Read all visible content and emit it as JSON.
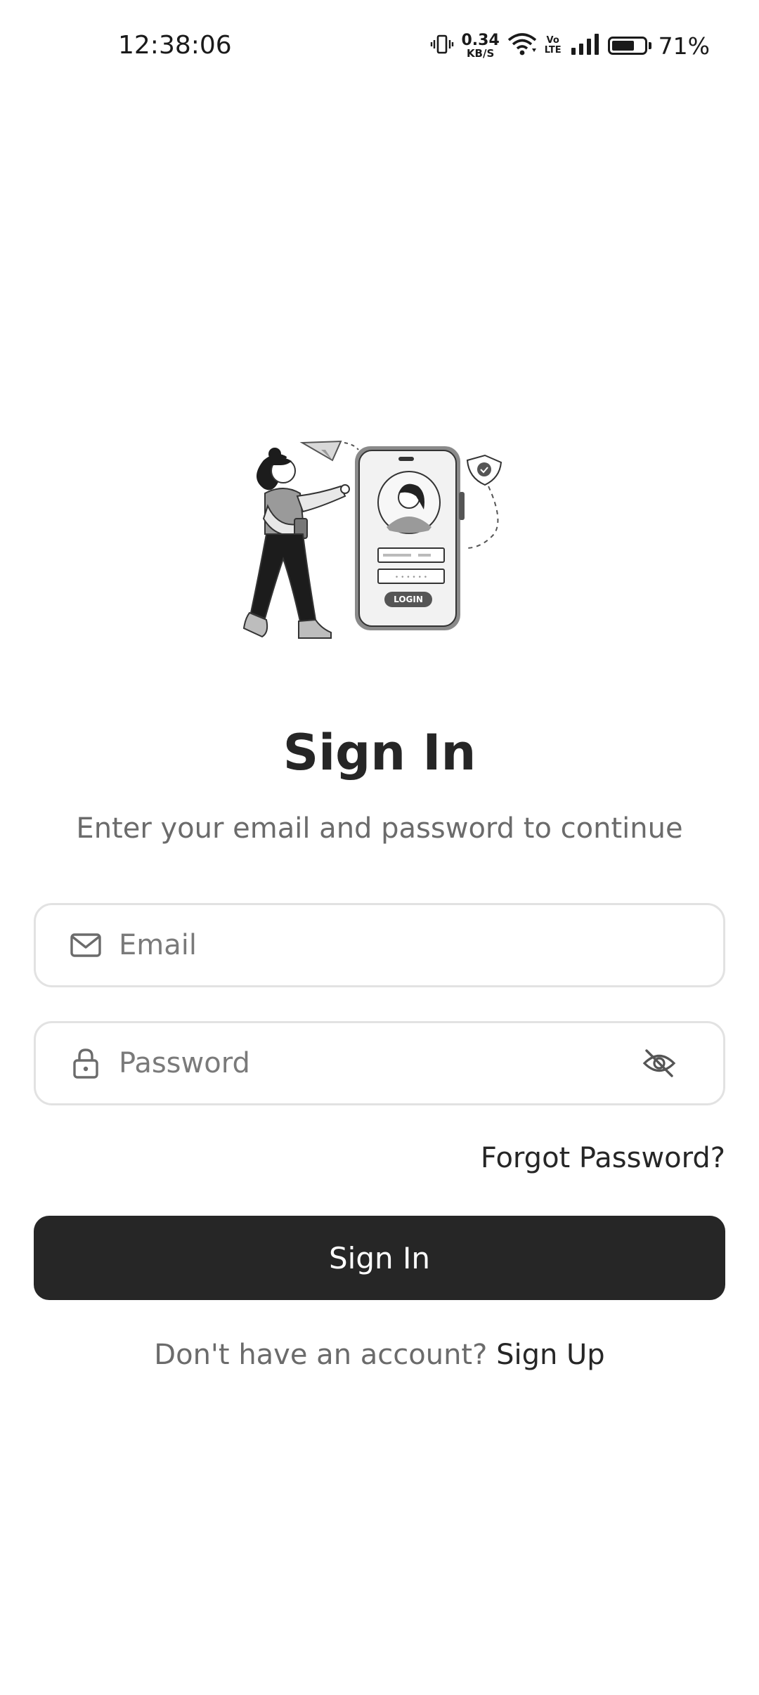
{
  "status_bar": {
    "time": "12:38:06",
    "net_speed_value": "0.34",
    "net_speed_unit": "KB/S",
    "volte_top": "Vo",
    "volte_bottom": "LTE",
    "battery_percent": "71%",
    "battery_level": 0.71,
    "icons": [
      "vibrate-icon",
      "wifi-icon",
      "volte-icon",
      "signal-icon",
      "battery-icon"
    ]
  },
  "illustration": {
    "description_icon": "login-illustration",
    "phone_button_label": "LOGIN"
  },
  "header": {
    "title": "Sign In",
    "subtitle": "Enter your email and password to continue"
  },
  "form": {
    "email": {
      "placeholder": "Email",
      "value": "",
      "icon": "mail-icon"
    },
    "password": {
      "placeholder": "Password",
      "value": "",
      "icon": "lock-icon",
      "toggle_icon": "eye-off-icon"
    },
    "forgot_label": "Forgot Password?",
    "submit_label": "Sign In"
  },
  "footer": {
    "prompt": "Don't have an account?",
    "link": "Sign Up"
  },
  "colors": {
    "primary": "#262626",
    "muted_text": "#6b6b6b",
    "border": "#e2e2e2",
    "background": "#ffffff"
  }
}
